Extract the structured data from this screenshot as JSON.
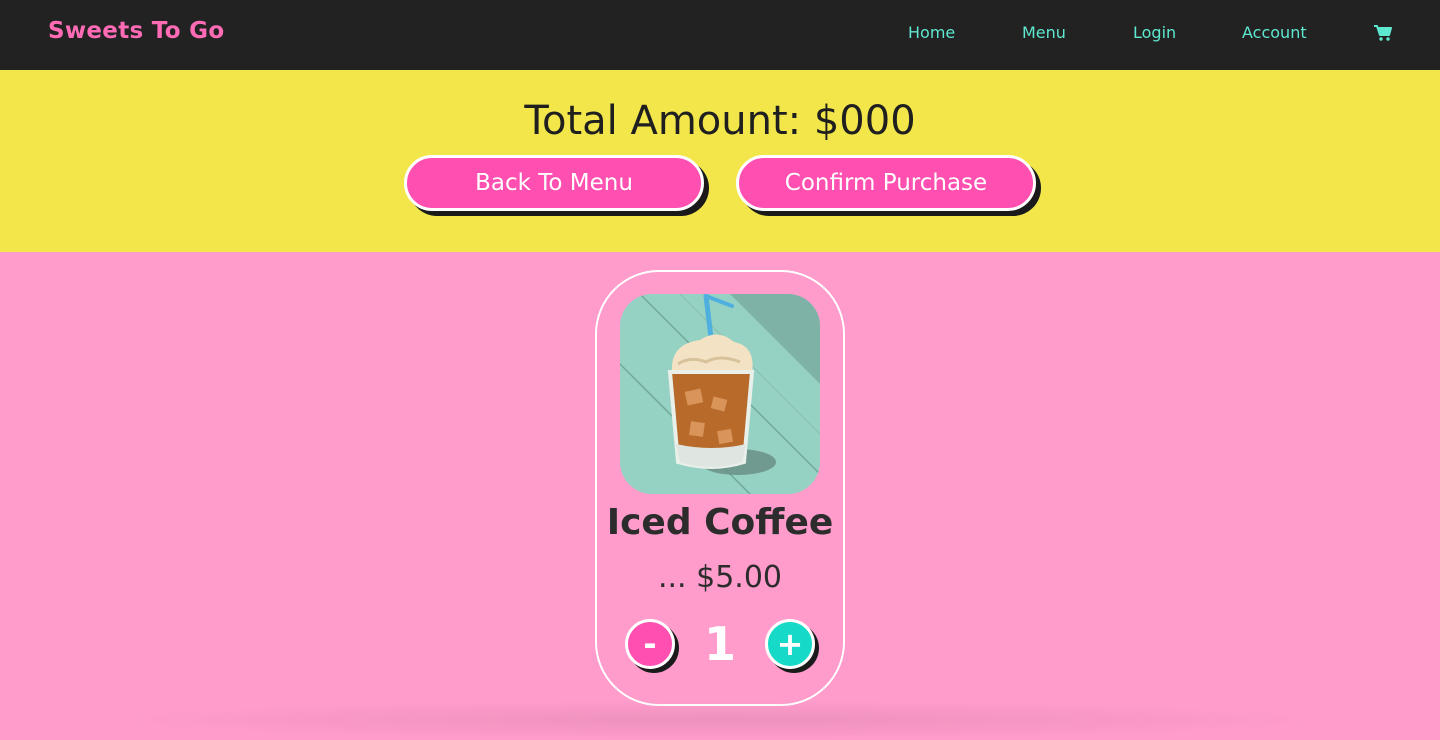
{
  "navbar": {
    "brand": "Sweets To Go",
    "links": [
      "Home",
      "Menu",
      "Login",
      "Account"
    ],
    "cart_icon": "shopping-cart-icon"
  },
  "summary": {
    "total_text": "Total Amount: $000",
    "back_label": "Back To Menu",
    "confirm_label": "Confirm Purchase"
  },
  "cart_item": {
    "name": "Iced Coffee",
    "price_text": "... $5.00",
    "quantity": "1",
    "minus_label": "-",
    "plus_label": "+",
    "image_icon": "iced-coffee-image"
  },
  "colors": {
    "navbar_bg": "#222222",
    "brand": "#ff6bb5",
    "nav_link": "#5ee8cf",
    "summary_bg": "#f2e64a",
    "page_bg": "#ff9ccb",
    "button_pink": "#ff4fb0",
    "button_teal": "#17d9c8"
  }
}
